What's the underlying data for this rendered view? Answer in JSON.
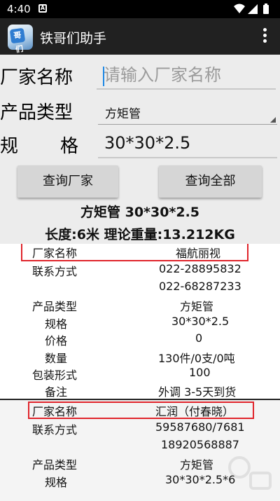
{
  "status_bar": {
    "time": "4:40",
    "notification_letter": "A"
  },
  "app_bar": {
    "title": "铁哥们助手",
    "icon_text": "哥们"
  },
  "form": {
    "manufacturer_label": "厂家名称",
    "manufacturer_placeholder": "请输入厂家名称",
    "manufacturer_value": "",
    "product_type_label": "产品类型",
    "product_type_value": "方矩管",
    "spec_label_1": "规",
    "spec_label_2": "格",
    "spec_value": "30*30*2.5"
  },
  "buttons": {
    "query_manufacturer": "查询厂家",
    "query_all": "查询全部"
  },
  "summary": {
    "line1": "方矩管 30*30*2.5",
    "line2": "长度:6米 理论重量:13.212KG"
  },
  "results": [
    {
      "manufacturer_key": "厂家名称",
      "manufacturer": "福航丽视",
      "contact_key": "联系方式",
      "contact_1": "022-28895832",
      "contact_2": "022-68287233",
      "type_key": "产品类型",
      "type": "方矩管",
      "spec_key": "规格",
      "spec": "30*30*2.5",
      "price_key": "价格",
      "price": "0",
      "quantity_key": "数量",
      "quantity": "130件/0支/0吨",
      "packaging_key": "包装形式",
      "packaging": "100",
      "remark_key": "备注",
      "remark": "外调 3-5天到货"
    },
    {
      "manufacturer_key": "厂家名称",
      "manufacturer": "汇润（付春晓）",
      "contact_key": "联系方式",
      "contact_1": "59587680/7681",
      "contact_2": "18920568887",
      "type_key": "产品类型",
      "type": "方矩管",
      "spec_key": "规格",
      "spec": "30*30*2.5*6"
    }
  ],
  "colors": {
    "highlight": "#e0242b",
    "app_bar": "#212121",
    "form_bg": "#ececec",
    "cursor": "#1e88e5"
  },
  "icons": [
    "app-logo-icon",
    "wifi-icon",
    "signal-icon",
    "battery-icon",
    "overflow-menu-icon",
    "dropdown-arrow-icon"
  ]
}
